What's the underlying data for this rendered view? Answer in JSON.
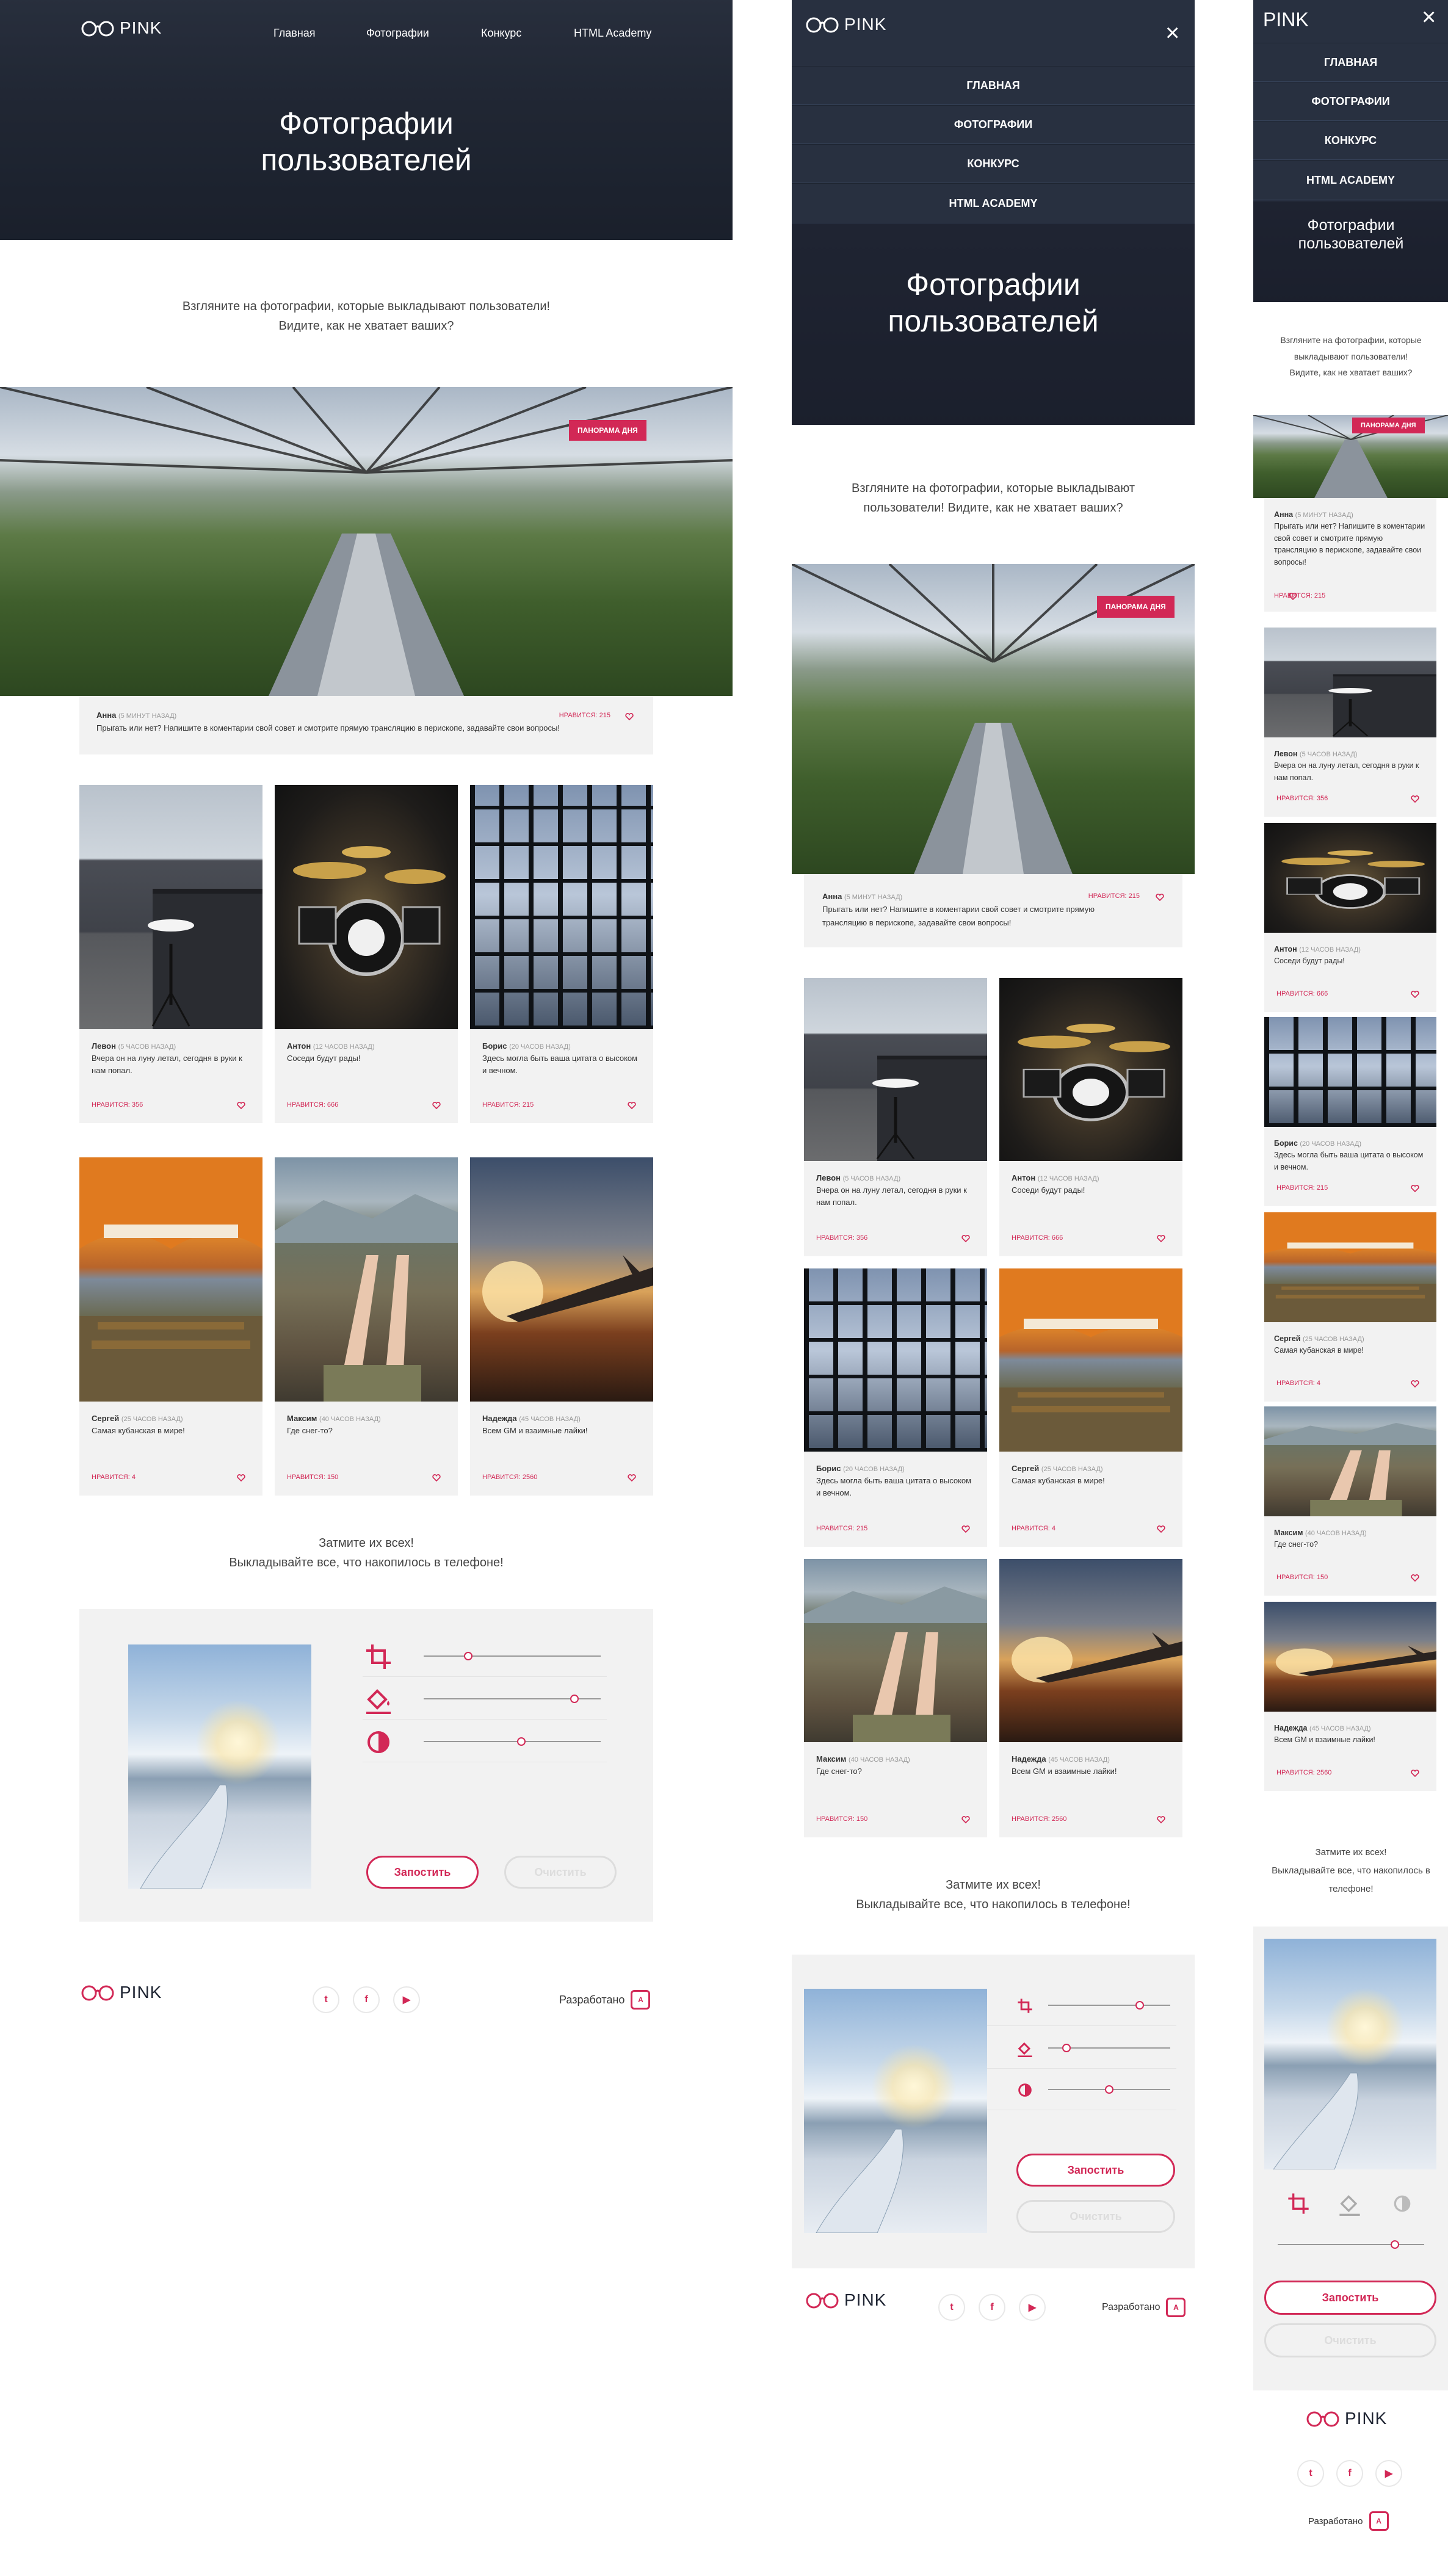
{
  "brand": {
    "name": "PINK",
    "accent": "#d22856",
    "dark": "#283040"
  },
  "nav": {
    "home": "Главная",
    "photos": "Фотографии",
    "contest": "Конкурс",
    "academy": "HTML Academy"
  },
  "nav_upper": {
    "home": "ГЛАВНАЯ",
    "photos": "ФОТОГРАФИИ",
    "contest": "КОНКУРС",
    "academy": "HTML ACADEMY"
  },
  "hero": {
    "title_line1": "Фотографии",
    "title_line2": "пользователей"
  },
  "intro": {
    "line1": "Взгляните на фотографии, которые выкладывают пользователи!",
    "line2": "Видите, как не хватает ваших?",
    "tab_line1": "Взгляните на фотографии, которые выкладывают",
    "tab_line2": "пользователи! Видите, как не хватает ваших?",
    "mob_line1": "Взгляните на фотографии, которые",
    "mob_line2": "выкладывают пользователи!",
    "mob_line3": "Видите, как не хватает ваших?"
  },
  "panorama": {
    "badge": "ПАНОРАМА ДНЯ",
    "author": "Анна",
    "time": "(5 МИНУТ НАЗАД)",
    "text": "Прыгать или нет? Напишите в коментарии свой совет и смотрите прямую трансляцию в перископе, задавайте свои вопросы!",
    "tab_text_1": "Прыгать или нет? Напишите в коментарии свой совет и смотрите прямую",
    "tab_text_2": "трансляцию в перископе, задавайте свои вопросы!",
    "mob_text": "Прыгать или нет? Напишите в коментарии свой совет и смотрите прямую трансляцию в перископе, задавайте свои вопросы!",
    "likes": "НРАВИТСЯ: 215"
  },
  "posts": [
    {
      "author": "Левон",
      "time": "(5 ЧАСОВ НАЗАД)",
      "text": "Вчера он на луну летал, сегодня в руки к нам попал.",
      "likes": "НРАВИТСЯ: 356",
      "photo": "car"
    },
    {
      "author": "Антон",
      "time": "(12 ЧАСОВ НАЗАД)",
      "text": "Соседи будут рады!",
      "likes": "НРАВИТСЯ: 666",
      "photo": "drum"
    },
    {
      "author": "Борис",
      "time": "(20 ЧАСОВ НАЗАД)",
      "text": "Здесь могла быть ваша цитата о высоком и вечном.",
      "likes": "НРАВИТСЯ: 215",
      "photo": "glass"
    },
    {
      "author": "Сергей",
      "time": "(25 ЧАСОВ НАЗАД)",
      "text": "Самая кубанская в мире!",
      "likes": "НРАВИТСЯ: 4",
      "photo": "tent"
    },
    {
      "author": "Максим",
      "time": "(40 ЧАСОВ НАЗАД)",
      "text": "Где снег-то?",
      "likes": "НРАВИТСЯ: 150",
      "photo": "legs"
    },
    {
      "author": "Надежда",
      "time": "(45 ЧАСОВ НАЗАД)",
      "text": "Всем GM и взаимные лайки!",
      "likes": "НРАВИТСЯ: 2560",
      "photo": "plane"
    }
  ],
  "cta": {
    "line1": "Затмите их всех!",
    "line2": "Выкладывайте все, что накопилось в телефоне!",
    "mob_line1": "Затмите их всех!",
    "mob_line2": "Выкладывайте все, что накопилось в",
    "mob_line3": "телефоне!"
  },
  "editor": {
    "upload": "Запостить",
    "reset": "Очистить",
    "icons": [
      "crop-icon",
      "fill-icon",
      "contrast-icon"
    ],
    "desk_levels": [
      0.25,
      0.85,
      0.55
    ],
    "tab_levels": [
      0.75,
      0.15,
      0.5
    ],
    "mob_level": 0.8
  },
  "social": {
    "twitter": "t",
    "facebook": "f",
    "youtube": "▶"
  },
  "footer": {
    "dev": "Разработано",
    "dev_mark": "A"
  }
}
